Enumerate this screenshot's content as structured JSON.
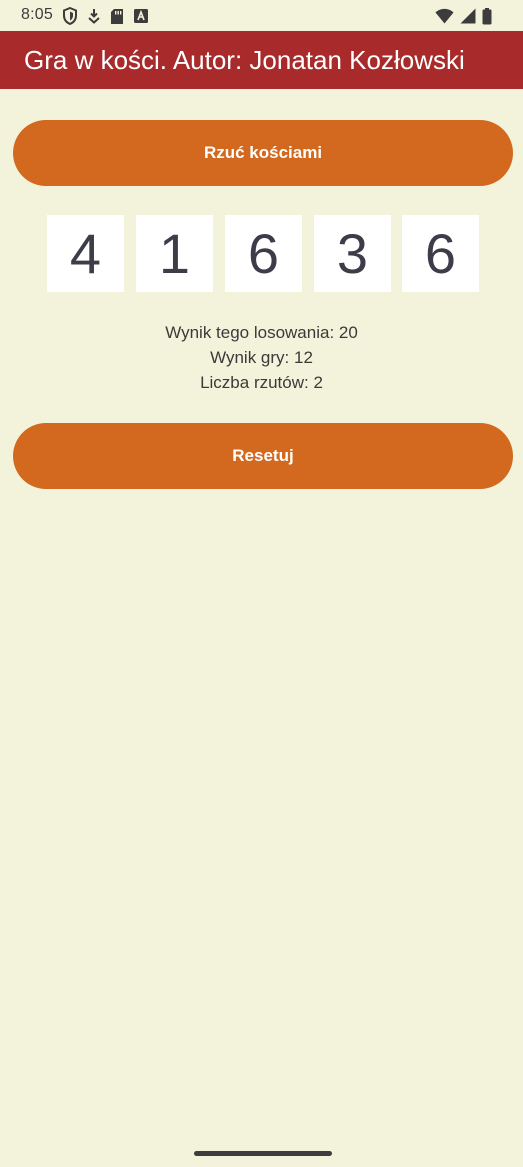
{
  "status_bar": {
    "time": "8:05",
    "left_icons": [
      "shield-icon",
      "download-icon",
      "sd-card-icon",
      "font-a-icon"
    ],
    "right_icons": [
      "wifi-icon",
      "signal-icon",
      "battery-icon"
    ]
  },
  "app_bar": {
    "title": "Gra w kości. Autor: Jonatan Kozłowski",
    "background": "#a82a2a"
  },
  "roll_button": {
    "label": "Rzuć kościami"
  },
  "dice": [
    "4",
    "1",
    "6",
    "3",
    "6"
  ],
  "results": {
    "roll_score": "Wynik tego losowania: 20",
    "game_score": "Wynik gry: 12",
    "roll_count": "Liczba rzutów: 2"
  },
  "reset_button": {
    "label": "Resetuj"
  },
  "colors": {
    "accent": "#d2691e",
    "background": "#f3f3dc",
    "app_bar": "#a82a2a"
  }
}
